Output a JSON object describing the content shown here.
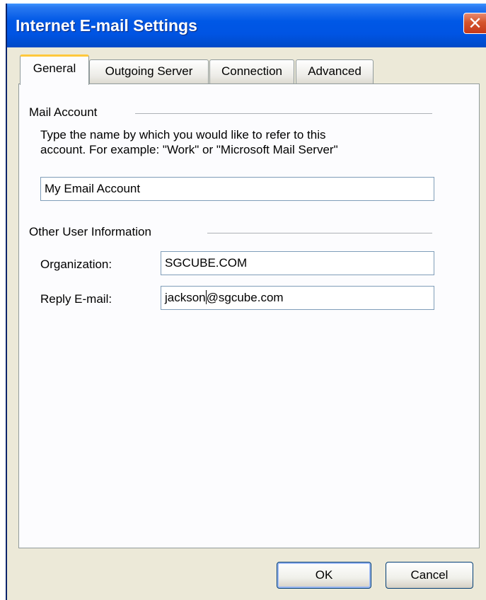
{
  "window": {
    "title": "Internet E-mail Settings"
  },
  "tabs": [
    {
      "label": "General",
      "active": true
    },
    {
      "label": "Outgoing Server",
      "active": false
    },
    {
      "label": "Connection",
      "active": false
    },
    {
      "label": "Advanced",
      "active": false
    }
  ],
  "mail_account": {
    "group_title": "Mail Account",
    "description_line1": "Type the name by which you would like to refer to this",
    "description_line2": "account.  For example: \"Work\" or \"Microsoft Mail Server\"",
    "account_name": "My Email Account"
  },
  "other_info": {
    "group_title": "Other User Information",
    "organization_label": "Organization:",
    "organization_value": "SGCUBE.COM",
    "reply_label": "Reply E-mail:",
    "reply_value_before_caret": "jackson",
    "reply_value_after_caret": "@sgcube.com"
  },
  "buttons": {
    "ok": "OK",
    "cancel": "Cancel"
  },
  "icons": {
    "close": "close-icon"
  },
  "colors": {
    "titlebar": "#0054e3",
    "dialog_bg": "#ece9d8",
    "active_tab_highlight": "#ffc83c"
  }
}
